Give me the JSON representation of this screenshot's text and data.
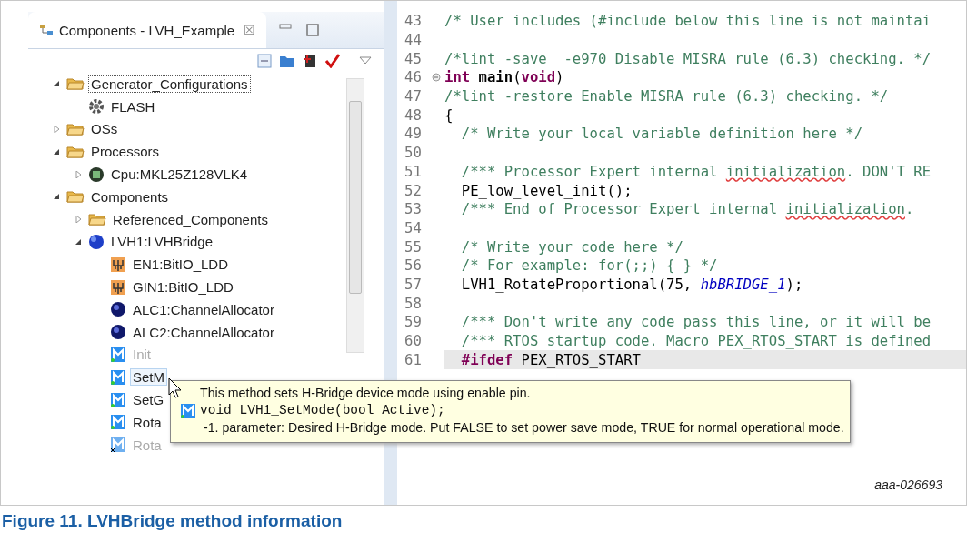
{
  "panel": {
    "tab_title": "Components - LVH_Example",
    "close_glyph": "☒"
  },
  "tree": [
    {
      "label": "Generator_Configurations",
      "kind": "folder",
      "expanded": true,
      "selected": false,
      "focused": true,
      "disabled": false,
      "children": [
        {
          "label": "FLASH",
          "kind": "gear",
          "selected": false,
          "focused": false,
          "disabled": false
        }
      ]
    },
    {
      "label": "OSs",
      "kind": "folder",
      "expanded": false,
      "selected": false,
      "focused": false,
      "disabled": false
    },
    {
      "label": "Processors",
      "kind": "folder",
      "expanded": true,
      "selected": false,
      "focused": false,
      "disabled": false,
      "children": [
        {
          "label": "Cpu:MKL25Z128VLK4",
          "kind": "chip",
          "expanded": false,
          "selected": false,
          "focused": false,
          "disabled": false
        }
      ]
    },
    {
      "label": "Components",
      "kind": "folder",
      "expanded": true,
      "selected": false,
      "focused": false,
      "disabled": false,
      "children": [
        {
          "label": "Referenced_Components",
          "kind": "folder",
          "expanded": false,
          "selected": false,
          "focused": false,
          "disabled": false
        },
        {
          "label": "LVH1:LVHBridge",
          "kind": "component",
          "expanded": true,
          "selected": false,
          "focused": false,
          "disabled": false,
          "children": [
            {
              "label": "EN1:BitIO_LDD",
              "kind": "bitio",
              "selected": false,
              "focused": false,
              "disabled": false
            },
            {
              "label": "GIN1:BitIO_LDD",
              "kind": "bitio",
              "selected": false,
              "focused": false,
              "disabled": false
            },
            {
              "label": "ALC1:ChannelAllocator",
              "kind": "user",
              "selected": false,
              "focused": false,
              "disabled": false
            },
            {
              "label": "ALC2:ChannelAllocator",
              "kind": "user",
              "selected": false,
              "focused": false,
              "disabled": false
            },
            {
              "label": "Init",
              "kind": "method",
              "selected": false,
              "focused": false,
              "disabled": true
            },
            {
              "label": "SetM",
              "kind": "method",
              "selected": true,
              "focused": false,
              "disabled": false
            },
            {
              "label": "SetG",
              "kind": "method",
              "selected": false,
              "focused": false,
              "disabled": false
            },
            {
              "label": "Rota",
              "kind": "method",
              "selected": false,
              "focused": false,
              "disabled": false
            },
            {
              "label": "Rota",
              "kind": "method-off",
              "selected": false,
              "focused": false,
              "disabled": true
            }
          ]
        }
      ]
    }
  ],
  "code": [
    {
      "num": "43",
      "highlighted": false,
      "fold": false,
      "segments": [
        {
          "kind": "comment",
          "text": "/* User includes (#include below this line is not maintai"
        }
      ]
    },
    {
      "num": "44",
      "highlighted": false,
      "fold": false
    },
    {
      "num": "45",
      "highlighted": false,
      "fold": false,
      "segments": [
        {
          "kind": "comment",
          "text": "/*lint -save  -e970 Disable MISRA rule (6.3) checking. */"
        }
      ]
    },
    {
      "num": "46",
      "highlighted": false,
      "fold": true,
      "segments": [
        {
          "kind": "keyword",
          "text": "int"
        },
        {
          "kind": "function",
          "text": " main"
        },
        {
          "kind": "plain",
          "text": "("
        },
        {
          "kind": "keyword",
          "text": "void"
        },
        {
          "kind": "plain",
          "text": ")"
        }
      ]
    },
    {
      "num": "47",
      "highlighted": false,
      "fold": false,
      "segments": [
        {
          "kind": "comment",
          "text": "/*lint -restore Enable MISRA rule (6.3) checking. */"
        }
      ]
    },
    {
      "num": "48",
      "highlighted": false,
      "fold": false,
      "segments": [
        {
          "kind": "plain",
          "text": "{"
        }
      ]
    },
    {
      "num": "49",
      "highlighted": false,
      "fold": false,
      "segments": [
        {
          "kind": "comment",
          "text": "  /* Write your local variable definition here */"
        }
      ]
    },
    {
      "num": "50",
      "highlighted": false,
      "fold": false
    },
    {
      "num": "51",
      "highlighted": false,
      "fold": false,
      "segments": [
        {
          "kind": "comment",
          "text": "  /*** Processor Expert internal "
        },
        {
          "kind": "misspelled",
          "text": "initialization"
        },
        {
          "kind": "comment",
          "text": ". DON'T RE"
        }
      ]
    },
    {
      "num": "52",
      "highlighted": false,
      "fold": false,
      "segments": [
        {
          "kind": "plain",
          "text": "  PE_low_level_init();"
        }
      ]
    },
    {
      "num": "53",
      "highlighted": false,
      "fold": false,
      "segments": [
        {
          "kind": "comment",
          "text": "  /*** End of Processor Expert internal "
        },
        {
          "kind": "misspelled",
          "text": "initialization"
        },
        {
          "kind": "comment",
          "text": "."
        }
      ]
    },
    {
      "num": "54",
      "highlighted": false,
      "fold": false
    },
    {
      "num": "55",
      "highlighted": false,
      "fold": false,
      "segments": [
        {
          "kind": "comment",
          "text": "  /* Write your code here */"
        }
      ]
    },
    {
      "num": "56",
      "highlighted": false,
      "fold": false,
      "segments": [
        {
          "kind": "comment",
          "text": "  /* For example: for(;;) { } */"
        }
      ]
    },
    {
      "num": "57",
      "highlighted": false,
      "fold": false,
      "segments": [
        {
          "kind": "plain",
          "text": "  LVH1_RotateProportional(75, "
        },
        {
          "kind": "constant",
          "text": "hbBRIDGE_1"
        },
        {
          "kind": "plain",
          "text": ");"
        }
      ]
    },
    {
      "num": "58",
      "highlighted": false,
      "fold": false
    },
    {
      "num": "59",
      "highlighted": false,
      "fold": false,
      "segments": [
        {
          "kind": "comment",
          "text": "  /*** Don't write any code pass this line, or it will be"
        }
      ]
    },
    {
      "num": "60",
      "highlighted": false,
      "fold": false,
      "segments": [
        {
          "kind": "comment",
          "text": "  /*** RTOS startup code. Macro PEX_RTOS_START is defined"
        }
      ]
    },
    {
      "num": "61",
      "highlighted": true,
      "fold": false,
      "segments": [
        {
          "kind": "keyword",
          "text": "  #ifdef"
        },
        {
          "kind": "plain",
          "text": " PEX_RTOS_START"
        }
      ]
    }
  ],
  "tooltip": {
    "description": "This method sets H-Bridge device mode using enable pin.",
    "signature": "void LVH1_SetMode(bool Active);",
    "parameter": "-1. parameter: Desired H-Bridge mode. Put FALSE to set power save mode, TRUE for normal operational mode."
  },
  "figure_id": "aaa-026693",
  "caption": "Figure 11. LVHBridge method information"
}
